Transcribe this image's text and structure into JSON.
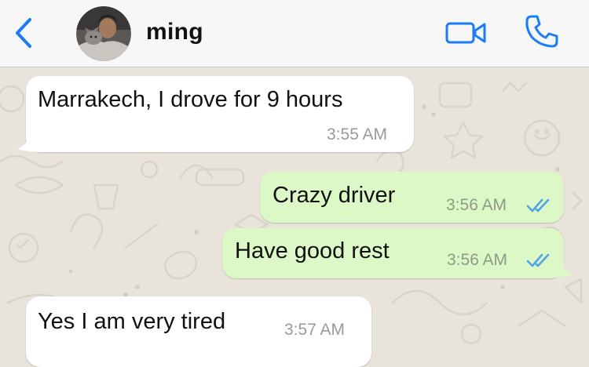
{
  "contact": {
    "name": "ming",
    "avatar_icon": "person-photo"
  },
  "header": {
    "back_icon": "chevron-left-icon",
    "video_icon": "video-camera-icon",
    "call_icon": "phone-icon",
    "accent_color": "#1a7cf6"
  },
  "messages": [
    {
      "direction": "incoming",
      "text": "Marrakech, I drove for 9 hours",
      "time": "3:55 AM"
    },
    {
      "direction": "outgoing",
      "text": "Crazy driver",
      "time": "3:56 AM",
      "status": "read"
    },
    {
      "direction": "outgoing",
      "text": "Have good rest",
      "time": "3:56 AM",
      "status": "read"
    },
    {
      "direction": "incoming",
      "text": "Yes I am very tired",
      "time": "3:57 AM"
    }
  ],
  "colors": {
    "incoming_bubble": "#ffffff",
    "outgoing_bubble": "#dcf8c6",
    "read_ticks": "#4fa5e8",
    "wallpaper": "#e9e4db"
  }
}
